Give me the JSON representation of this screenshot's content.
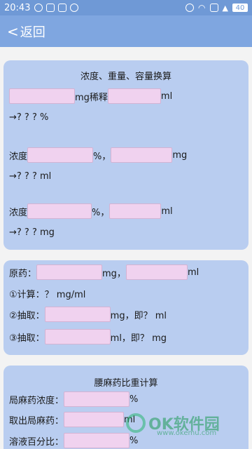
{
  "status_bar": {
    "time": "20:43",
    "battery": "40",
    "icons_left": [
      "message-icon",
      "message-icon",
      "mail-icon",
      "check-icon"
    ],
    "icons_right": [
      "alarm-icon",
      "wifi-icon",
      "mail-icon",
      "signal-icon",
      "battery-icon"
    ]
  },
  "header": {
    "back_label": "返回"
  },
  "card1": {
    "title": "浓度、重量、容量换算",
    "r1": {
      "unit1": "mg稀释",
      "unit2": "ml",
      "result": "→? ? ? %"
    },
    "r2": {
      "label": "浓度",
      "unit1": "%，",
      "unit2": "mg",
      "result": "→? ? ? ml"
    },
    "r3": {
      "label": "浓度",
      "unit1": "%，",
      "unit2": "ml",
      "result": "→? ? ? mg"
    }
  },
  "card2": {
    "r1": {
      "label": "原药：",
      "unit1": "mg，",
      "unit2": "ml"
    },
    "r2": {
      "text": "①计算：？ mg/ml"
    },
    "r3": {
      "label": "②抽取：",
      "unit": "mg，即？ ml"
    },
    "r4": {
      "label": "③抽取：",
      "unit": "ml，即？ mg"
    }
  },
  "card3": {
    "title": "腰麻药比重计算",
    "r1": {
      "label": "局麻药浓度：",
      "unit": "%"
    },
    "r2": {
      "label": "取出局麻药：",
      "unit": "ml"
    },
    "r3": {
      "label": "溶液百分比：",
      "unit": "%"
    }
  },
  "watermark": {
    "text": "OK软件园",
    "sub": "www.okemu.com"
  },
  "colors": {
    "status_bar": "#6f99d6",
    "app_bar": "#7fa6e0",
    "card": "#b9cdf0",
    "input": "#f0d2ef"
  }
}
